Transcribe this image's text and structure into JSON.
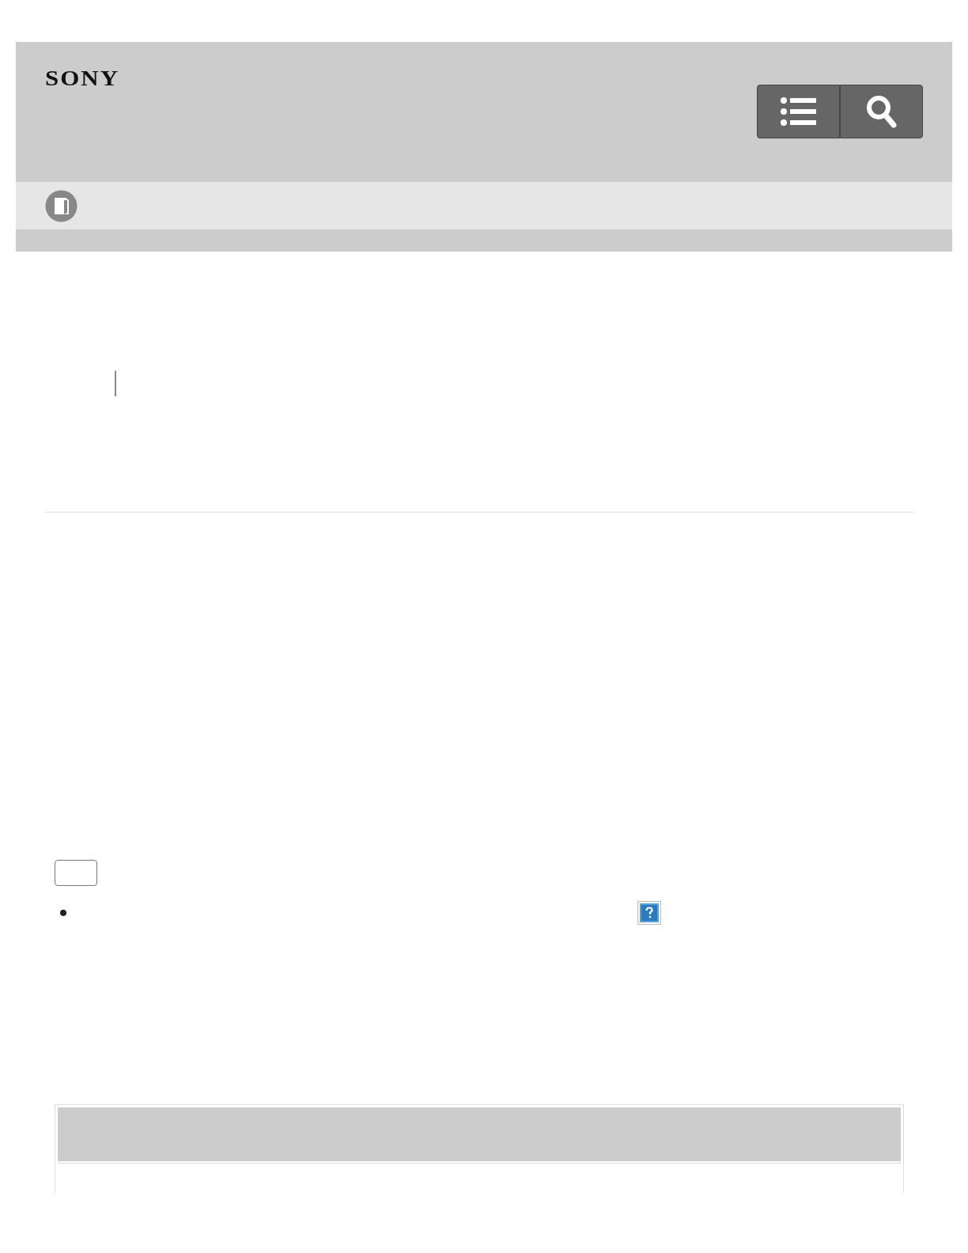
{
  "header": {
    "logo": "SONY"
  }
}
